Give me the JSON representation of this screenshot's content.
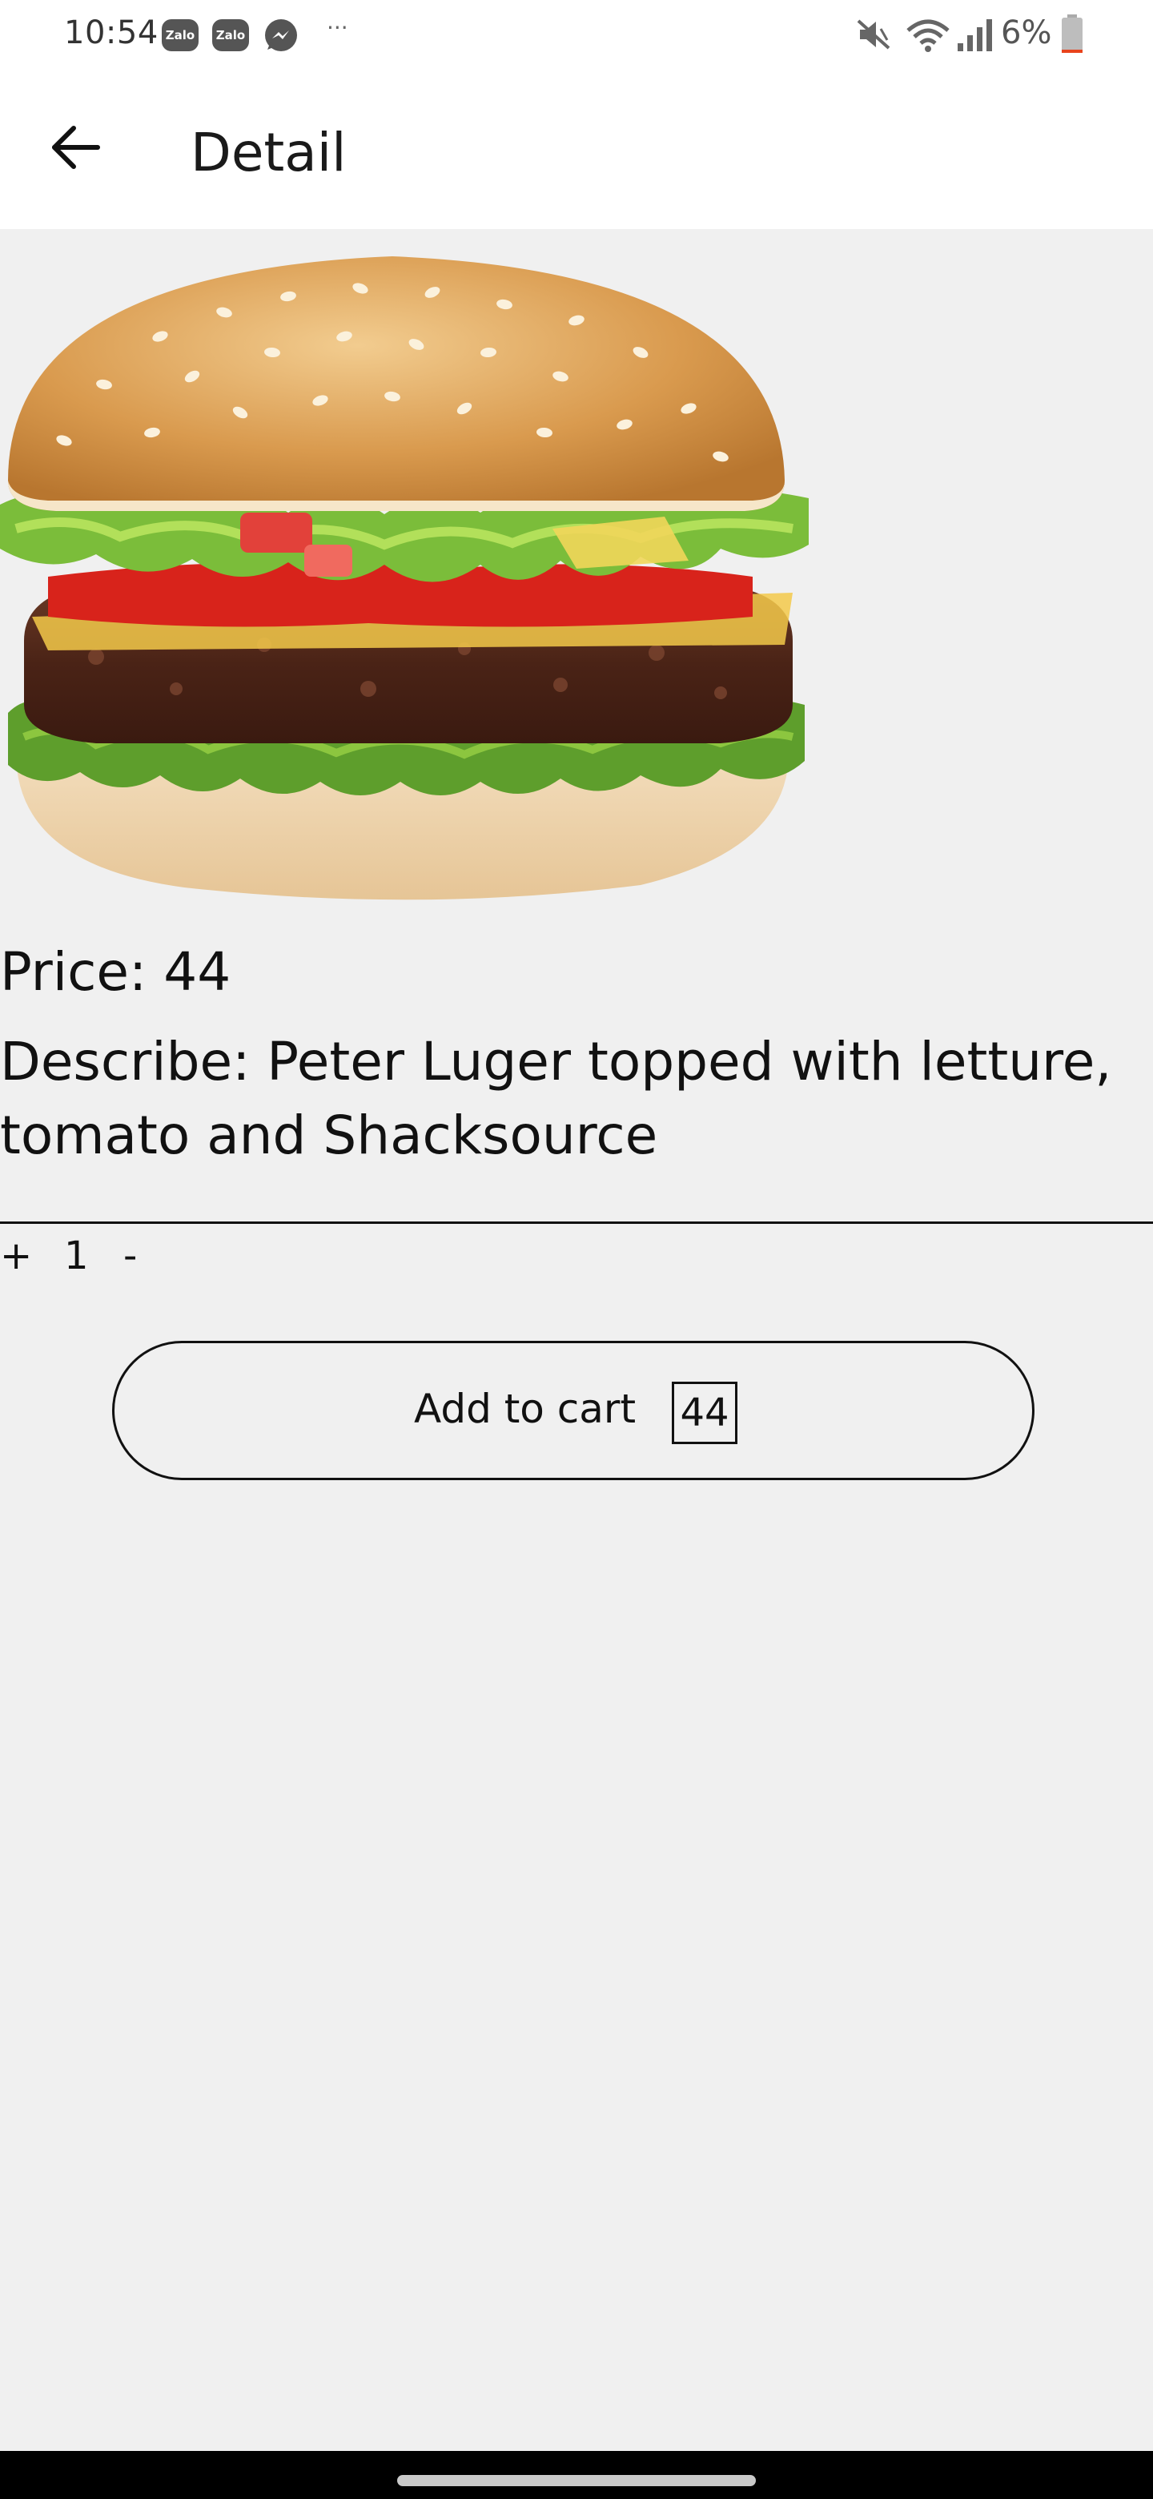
{
  "status_bar": {
    "time": "10:54",
    "notifications": [
      {
        "icon": "zalo-icon",
        "label": "Zalo"
      },
      {
        "icon": "zalo-icon",
        "label": "Zalo"
      },
      {
        "icon": "messenger-icon"
      }
    ],
    "more": "···",
    "battery_percent": "6%",
    "battery_level": 0.06,
    "icons": [
      "mute-icon",
      "wifi-icon",
      "signal-icon",
      "battery-icon"
    ]
  },
  "app_bar": {
    "back_icon": "arrow-left-icon",
    "title": "Detail"
  },
  "product": {
    "image": "burger-image",
    "price_label": "Price: 44",
    "description_label": "Describe: Peter Luger topped with letture, tomato and Shacksource"
  },
  "quantity": {
    "plus": "+",
    "value": "1",
    "minus": "-"
  },
  "cart": {
    "button_label": "Add to cart",
    "total": "44"
  },
  "colors": {
    "background": "#f0f0f0",
    "surface": "#ffffff",
    "text": "#111111",
    "nav_bar": "#000000"
  }
}
